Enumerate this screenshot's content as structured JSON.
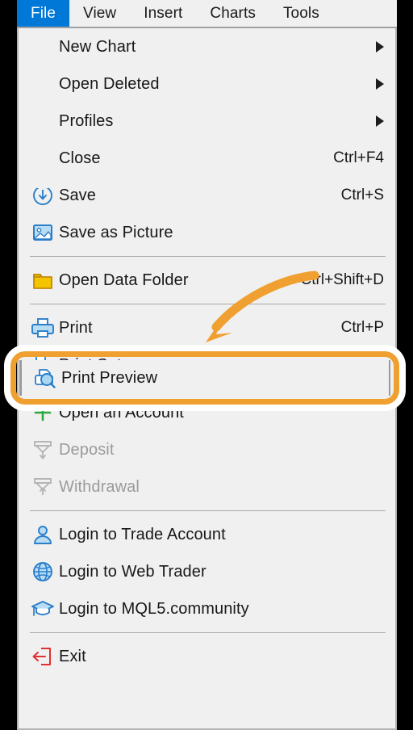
{
  "menubar": {
    "items": [
      {
        "label": "File",
        "active": true
      },
      {
        "label": "View",
        "active": false
      },
      {
        "label": "Insert",
        "active": false
      },
      {
        "label": "Charts",
        "active": false
      },
      {
        "label": "Tools",
        "active": false
      }
    ]
  },
  "menu": {
    "items": [
      {
        "label": "New Chart",
        "accel": "",
        "icon": "none",
        "submenu": true,
        "disabled": false
      },
      {
        "label": "Open Deleted",
        "accel": "",
        "icon": "none",
        "submenu": true,
        "disabled": false
      },
      {
        "label": "Profiles",
        "accel": "",
        "icon": "none",
        "submenu": true,
        "disabled": false
      },
      {
        "label": "Close",
        "accel": "Ctrl+F4",
        "icon": "none",
        "submenu": false,
        "disabled": false
      },
      {
        "label": "Save",
        "accel": "Ctrl+S",
        "icon": "save-icon",
        "submenu": false,
        "disabled": false
      },
      {
        "label": "Save as Picture",
        "accel": "",
        "icon": "picture-icon",
        "submenu": false,
        "disabled": false
      },
      {
        "label": "Open Data Folder",
        "accel": "Ctrl+Shift+D",
        "icon": "folder-icon",
        "submenu": false,
        "disabled": false
      },
      {
        "label": "Print",
        "accel": "Ctrl+P",
        "icon": "printer-icon",
        "submenu": false,
        "disabled": false
      },
      {
        "label": "Print Setup",
        "accel": "",
        "icon": "print-setup-icon",
        "submenu": false,
        "disabled": false
      },
      {
        "label": "Open an Account",
        "accel": "",
        "icon": "plus-icon",
        "submenu": false,
        "disabled": false
      },
      {
        "label": "Deposit",
        "accel": "",
        "icon": "deposit-icon",
        "submenu": false,
        "disabled": true
      },
      {
        "label": "Withdrawal",
        "accel": "",
        "icon": "withdrawal-icon",
        "submenu": false,
        "disabled": true
      },
      {
        "label": "Login to Trade Account",
        "accel": "",
        "icon": "person-icon",
        "submenu": false,
        "disabled": false
      },
      {
        "label": "Login to Web Trader",
        "accel": "",
        "icon": "globe-icon",
        "submenu": false,
        "disabled": false
      },
      {
        "label": "Login to MQL5.community",
        "accel": "",
        "icon": "graduation-cap-icon",
        "submenu": false,
        "disabled": false
      },
      {
        "label": "Exit",
        "accel": "",
        "icon": "exit-icon",
        "submenu": false,
        "disabled": false
      }
    ]
  },
  "highlighted_item": {
    "label": "Print Preview",
    "accel": "",
    "icon": "print-preview-icon"
  },
  "annotation": {
    "type": "curved-arrow",
    "color": "#f0a030",
    "points_to": "Print Preview"
  },
  "colors": {
    "menubar_active_bg": "#0078d7",
    "menu_bg": "#f0f0f0",
    "highlight_orange": "#f0a030",
    "icon_blue": "#2a7fc9",
    "folder_yellow": "#f0c000",
    "plus_green": "#2eaa3c",
    "exit_red": "#e03030",
    "disabled_gray": "#9b9b9b"
  }
}
